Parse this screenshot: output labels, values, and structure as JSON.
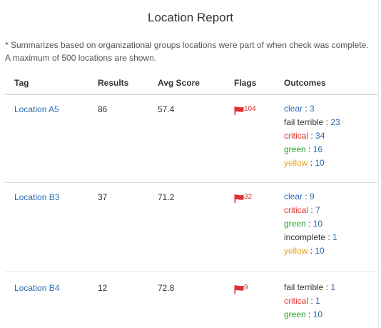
{
  "report": {
    "title": "Location Report",
    "note_line1": "* Summarizes based on organizational groups locations were part of when check was complete.",
    "note_line2": "A maximum of 500 locations are shown."
  },
  "columns": {
    "tag": "Tag",
    "results": "Results",
    "avg_score": "Avg Score",
    "flags": "Flags",
    "outcomes": "Outcomes"
  },
  "colors": {
    "link": "#2a6bb0",
    "clear": "#2a6bb0",
    "fail_terrible": "#333333",
    "critical": "#e02f2f",
    "green": "#27a327",
    "yellow": "#e8a317",
    "incomplete": "#333333",
    "flag": "#e02f2f"
  },
  "rows": [
    {
      "tag": "Location A5",
      "results": "86",
      "avg_score": "57.4",
      "flags": "104",
      "outcomes": [
        {
          "label": "clear",
          "value": "3",
          "kind": "clear"
        },
        {
          "label": "fail terrible",
          "value": "23",
          "kind": "fail_terrible"
        },
        {
          "label": "critical",
          "value": "34",
          "kind": "critical"
        },
        {
          "label": "green",
          "value": "16",
          "kind": "green"
        },
        {
          "label": "yellow",
          "value": "10",
          "kind": "yellow"
        }
      ]
    },
    {
      "tag": "Location B3",
      "results": "37",
      "avg_score": "71.2",
      "flags": "32",
      "outcomes": [
        {
          "label": "clear",
          "value": "9",
          "kind": "clear"
        },
        {
          "label": "critical",
          "value": "7",
          "kind": "critical"
        },
        {
          "label": "green",
          "value": "10",
          "kind": "green"
        },
        {
          "label": "incomplete",
          "value": "1",
          "kind": "incomplete"
        },
        {
          "label": "yellow",
          "value": "10",
          "kind": "yellow"
        }
      ]
    },
    {
      "tag": "Location B4",
      "results": "12",
      "avg_score": "72.8",
      "flags": "9",
      "outcomes": [
        {
          "label": "fail terrible",
          "value": "1",
          "kind": "fail_terrible"
        },
        {
          "label": "critical",
          "value": "1",
          "kind": "critical"
        },
        {
          "label": "green",
          "value": "10",
          "kind": "green"
        }
      ]
    }
  ]
}
